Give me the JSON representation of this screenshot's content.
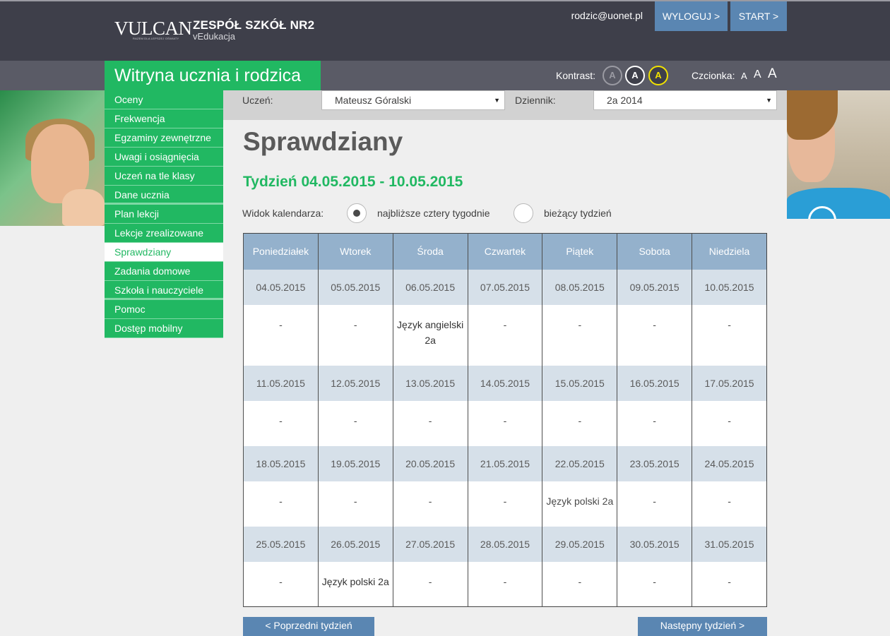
{
  "header": {
    "logo_text": "VULCAN",
    "logo_tagline": "RAZEM DLA LEPSZEJ OŚWIATY",
    "school_name": "ZESPÓŁ SZKÓŁ NR2",
    "app_name": "vEdukacja",
    "user_email": "rodzic@uonet.pl",
    "logout_label": "WYLOGUJ >",
    "start_label": "START >",
    "site_title": "Witryna ucznia i rodzica",
    "contrast_label": "Kontrast:",
    "contrast_options": [
      "A",
      "A",
      "A"
    ],
    "font_label": "Czcionka:",
    "font_sizes": [
      "A",
      "A",
      "A"
    ]
  },
  "sidebar": {
    "items": [
      {
        "label": "Oceny"
      },
      {
        "label": "Frekwencja"
      },
      {
        "label": "Egzaminy zewnętrzne"
      },
      {
        "label": "Uwagi i osiągnięcia"
      },
      {
        "label": "Uczeń na tle klasy"
      },
      {
        "label": "Dane ucznia"
      },
      {
        "label": "Plan lekcji"
      },
      {
        "label": "Lekcje zrealizowane"
      },
      {
        "label": "Sprawdziany"
      },
      {
        "label": "Zadania domowe"
      },
      {
        "label": "Szkoła i nauczyciele"
      },
      {
        "label": "Pomoc"
      },
      {
        "label": "Dostęp mobilny"
      }
    ],
    "active": "Sprawdziany"
  },
  "selectors": {
    "student_label": "Uczeń:",
    "student_value": "Mateusz Góralski",
    "journal_label": "Dziennik:",
    "journal_value": "2a 2014"
  },
  "main": {
    "title": "Sprawdziany",
    "week": "Tydzień 04.05.2015 - 10.05.2015",
    "view_label": "Widok kalendarza:",
    "view_options": [
      "najbliższe cztery tygodnie",
      "bieżący tydzień"
    ],
    "view_selected": "najbliższe cztery tygodnie"
  },
  "calendar": {
    "days": [
      "Poniedziałek",
      "Wtorek",
      "Środa",
      "Czwartek",
      "Piątek",
      "Sobota",
      "Niedziela"
    ],
    "weeks": [
      {
        "dates": [
          "04.05.2015",
          "05.05.2015",
          "06.05.2015",
          "07.05.2015",
          "08.05.2015",
          "09.05.2015",
          "10.05.2015"
        ],
        "events": [
          "-",
          "-",
          "Język angielski 2a",
          "-",
          "-",
          "-",
          "-"
        ]
      },
      {
        "dates": [
          "11.05.2015",
          "12.05.2015",
          "13.05.2015",
          "14.05.2015",
          "15.05.2015",
          "16.05.2015",
          "17.05.2015"
        ],
        "events": [
          "-",
          "-",
          "-",
          "-",
          "-",
          "-",
          "-"
        ]
      },
      {
        "dates": [
          "18.05.2015",
          "19.05.2015",
          "20.05.2015",
          "21.05.2015",
          "22.05.2015",
          "23.05.2015",
          "24.05.2015"
        ],
        "events": [
          "-",
          "-",
          "-",
          "-",
          "Język polski 2a",
          "-",
          "-"
        ]
      },
      {
        "dates": [
          "25.05.2015",
          "26.05.2015",
          "27.05.2015",
          "28.05.2015",
          "29.05.2015",
          "30.05.2015",
          "31.05.2015"
        ],
        "events": [
          "-",
          "Język polski 2a",
          "-",
          "-",
          "-",
          "-",
          "-"
        ]
      }
    ]
  },
  "pager": {
    "prev_label": "< Poprzedni tydzień",
    "next_label": "Następny tydzień >"
  }
}
